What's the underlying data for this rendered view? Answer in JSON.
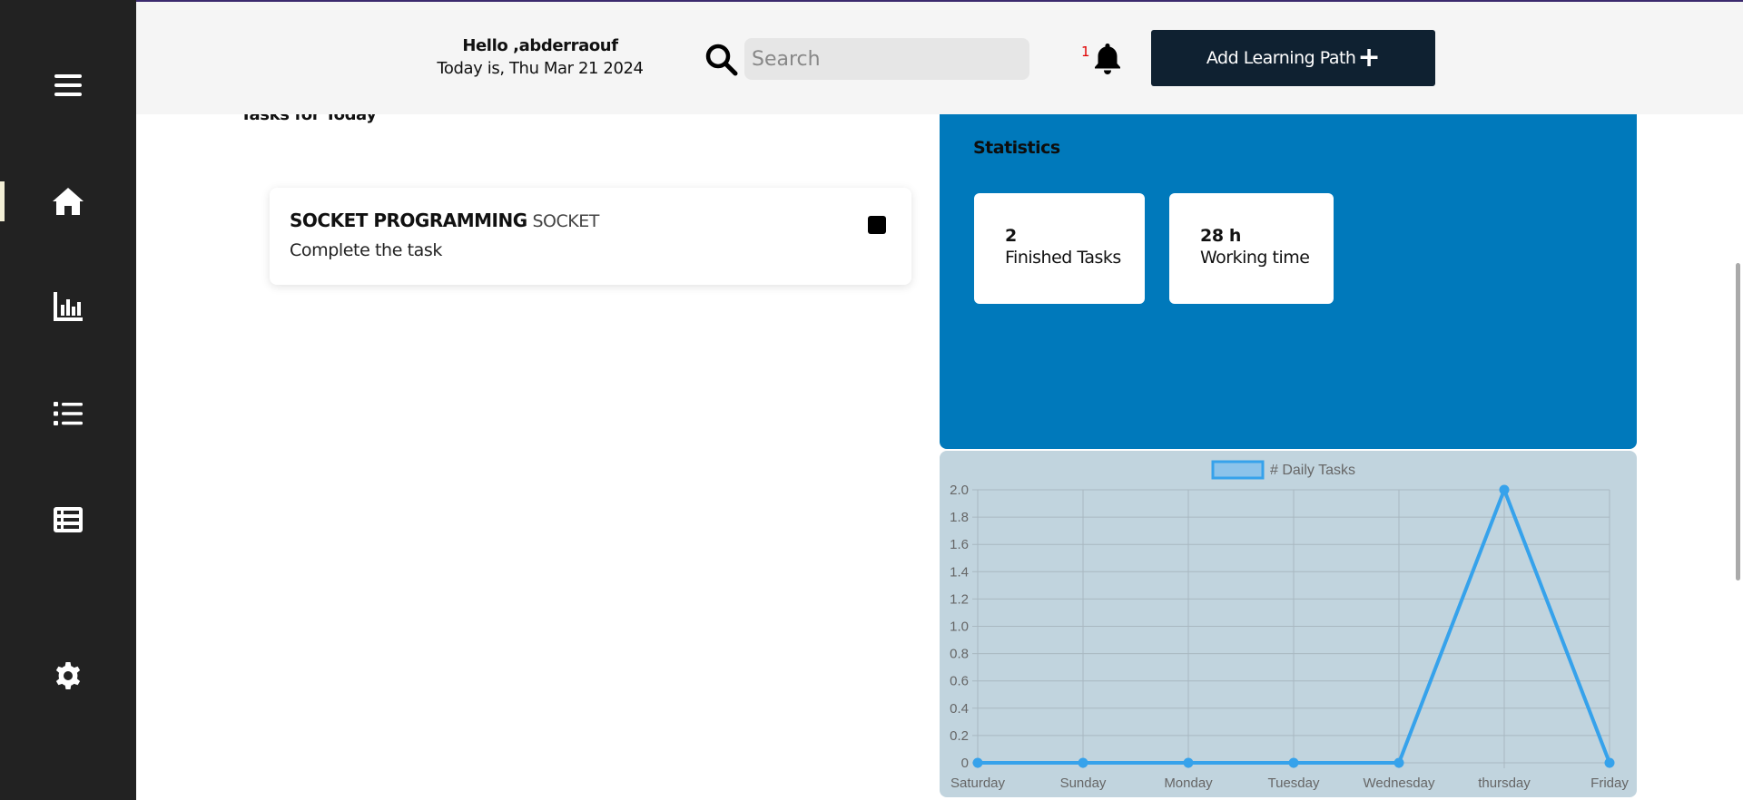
{
  "header": {
    "greeting": "Hello ,abderraouf",
    "date": "Today is, Thu Mar 21 2024",
    "search_placeholder": "Search",
    "notification_count": "1",
    "add_button_label": "Add Learning Path",
    "add_button_icon": "+"
  },
  "sidebar": {
    "items": [
      {
        "name": "menu",
        "icon": "hamburger-icon"
      },
      {
        "name": "home",
        "icon": "home-icon",
        "active": true
      },
      {
        "name": "statistics",
        "icon": "bar-chart-icon"
      },
      {
        "name": "list",
        "icon": "list-icon"
      },
      {
        "name": "table",
        "icon": "table-list-icon"
      },
      {
        "name": "settings",
        "icon": "gear-icon"
      }
    ]
  },
  "tasks": {
    "title": "Tasks for Today",
    "items": [
      {
        "name": "SOCKET PROGRAMMING",
        "tag": "SOCKET",
        "description": "Complete the task"
      }
    ]
  },
  "statistics": {
    "title": "Statistics",
    "cards": [
      {
        "value": "2",
        "label": "Finished Tasks"
      },
      {
        "value": "28 h",
        "label": "Working time"
      }
    ]
  },
  "colors": {
    "sidebar": "#222222",
    "stats_panel": "#0079bb",
    "chart_panel": "#c1d4de",
    "button": "#0f2131",
    "line": "#36a2eb"
  },
  "chart_data": {
    "type": "line",
    "categories": [
      "Saturday",
      "Sunday",
      "Monday",
      "Tuesday",
      "Wednesday",
      "thursday",
      "Friday"
    ],
    "series": [
      {
        "name": "# Daily Tasks",
        "values": [
          0,
          0,
          0,
          0,
          0,
          2,
          0
        ]
      }
    ],
    "yticks": [
      "0",
      "0.2",
      "0.4",
      "0.6",
      "0.8",
      "1.0",
      "1.2",
      "1.4",
      "1.6",
      "1.8",
      "2.0"
    ],
    "ylim": [
      0,
      2
    ],
    "grid": true,
    "legend": "top-center"
  }
}
